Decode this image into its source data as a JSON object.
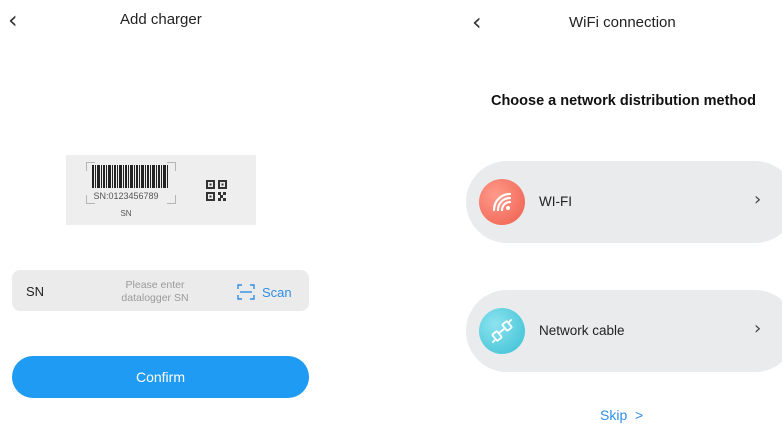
{
  "add_charger": {
    "title": "Add charger",
    "sample_card": {
      "sn_number": "SN:0123456789",
      "sn_caption": "SN"
    },
    "sn_field": {
      "label": "SN",
      "placeholder": "Please enter\ndatalogger SN",
      "scan_label": "Scan"
    },
    "confirm_label": "Confirm"
  },
  "wifi_connection": {
    "title": "WiFi connection",
    "heading": "Choose a network distribution method",
    "options": [
      {
        "label": "WI-FI",
        "icon": "wifi-icon",
        "color": "#f16d5c"
      },
      {
        "label": "Network cable",
        "icon": "cable-icon",
        "color": "#3ec3d6"
      }
    ],
    "skip_label": "Skip  >"
  },
  "colors": {
    "accent": "#1f9bf3",
    "link": "#2f8ee8"
  }
}
